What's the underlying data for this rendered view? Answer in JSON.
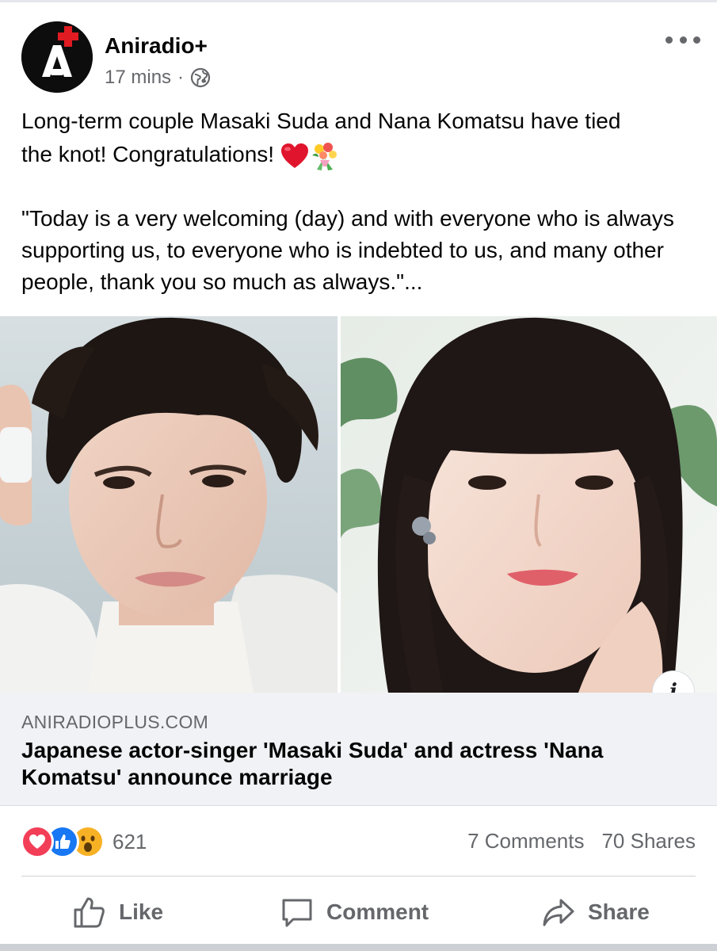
{
  "post": {
    "page_name": "Aniradio+",
    "time": "17 mins",
    "separator": "·",
    "audience_icon": "globe-icon",
    "more_icon": "more-options-icon",
    "text_line1": "Long-term couple Masaki Suda and Nana Komatsu have tied",
    "text_line2": "the knot! Congratulations! ",
    "emojis": [
      "red-heart-emoji",
      "bouquet-emoji"
    ],
    "quote": "\"Today is a very welcoming (day) and with everyone who is always supporting us, to everyone who is indebted to us, and many other people, thank you so much as always.\"..."
  },
  "link_preview": {
    "domain": "ANIRADIOPLUS.COM",
    "title": "Japanese actor-singer 'Masaki Suda' and actress 'Nana Komatsu' announce marriage",
    "info_label": "i"
  },
  "reactions": {
    "types": [
      "love",
      "like",
      "wow"
    ],
    "count": "621",
    "comments": "7 Comments",
    "shares": "70 Shares"
  },
  "actions": {
    "like": "Like",
    "comment": "Comment",
    "share": "Share"
  },
  "colors": {
    "brand_red": "#e11b22",
    "like_blue": "#1877f2",
    "love_red": "#f33e58",
    "wow_yellow": "#f7b125",
    "secondary_text": "#65676b"
  }
}
